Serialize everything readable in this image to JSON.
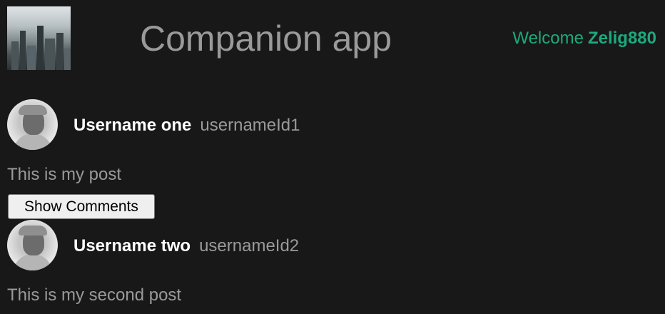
{
  "header": {
    "title": "Companion app",
    "welcome_text": "Welcome",
    "username": "Zelig880"
  },
  "posts": [
    {
      "display_name": "Username one",
      "username": "usernameId1",
      "text": "This is my post",
      "show_comments_label": "Show Comments"
    },
    {
      "display_name": "Username two",
      "username": "usernameId2",
      "text": "This is my second post"
    }
  ],
  "colors": {
    "background": "#181818",
    "accent": "#1ea97c",
    "muted_text": "#9a9a9a"
  }
}
